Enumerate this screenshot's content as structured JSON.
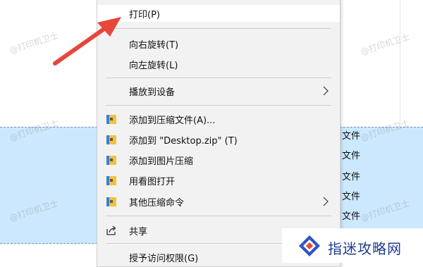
{
  "menu": {
    "items": [
      {
        "label": "打印(P)"
      },
      {
        "label": "向右旋转(T)"
      },
      {
        "label": "向左旋转(L)"
      },
      {
        "label": "播放到设备"
      },
      {
        "label": "添加到压缩文件(A)..."
      },
      {
        "label": "添加到 \"Desktop.zip\" (T)"
      },
      {
        "label": "添加到图片压缩"
      },
      {
        "label": "用看图打开"
      },
      {
        "label": "其他压缩命令"
      },
      {
        "label": "共享"
      },
      {
        "label": "授予访问权限(G)"
      }
    ]
  },
  "background": {
    "file_suffix": "文件"
  },
  "watermark": {
    "text": "@打印机卫士"
  },
  "logo": {
    "text": "指迷攻略网"
  },
  "colors": {
    "selection": "#cce8ff",
    "arrow": "#e8453c",
    "logo_blue": "#213b8f"
  }
}
